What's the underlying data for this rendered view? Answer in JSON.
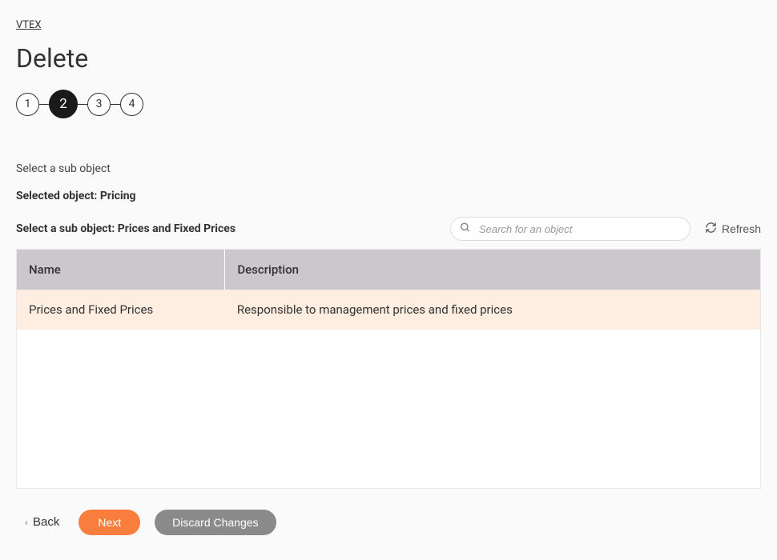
{
  "breadcrumb": {
    "label": "VTEX"
  },
  "page": {
    "title": "Delete"
  },
  "stepper": {
    "steps": [
      "1",
      "2",
      "3",
      "4"
    ],
    "active_index": 1
  },
  "content": {
    "instruction": "Select a sub object",
    "selected_object_label": "Selected object:",
    "selected_object_value": "Pricing",
    "sub_object_label": "Select a sub object:",
    "sub_object_value": "Prices and Fixed Prices"
  },
  "search": {
    "placeholder": "Search for an object"
  },
  "refresh": {
    "label": "Refresh"
  },
  "table": {
    "headers": {
      "name": "Name",
      "description": "Description"
    },
    "rows": [
      {
        "name": "Prices and Fixed Prices",
        "description": "Responsible to management prices and fixed prices"
      }
    ]
  },
  "actions": {
    "back": "Back",
    "next": "Next",
    "discard": "Discard Changes"
  }
}
